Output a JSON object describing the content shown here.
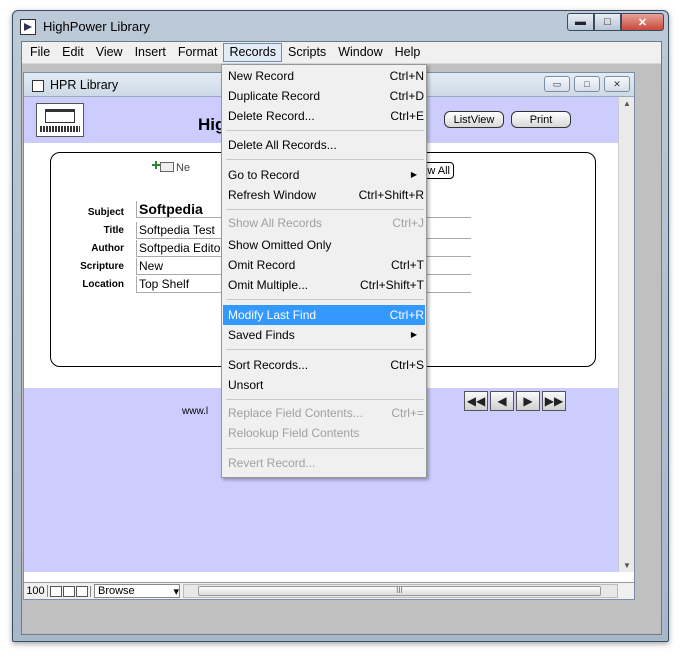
{
  "app": {
    "title": "HighPower Library"
  },
  "window_controls": {
    "minimize": "▬",
    "maximize": "□",
    "close": "✕"
  },
  "menubar": [
    {
      "label": "File"
    },
    {
      "label": "Edit"
    },
    {
      "label": "View"
    },
    {
      "label": "Insert"
    },
    {
      "label": "Format"
    },
    {
      "label": "Records"
    },
    {
      "label": "Scripts"
    },
    {
      "label": "Window"
    },
    {
      "label": "Help"
    }
  ],
  "doc_window": {
    "title": "HPR Library",
    "controls": [
      "▭",
      "□",
      "✕"
    ]
  },
  "header": {
    "heading": "Hig",
    "listview_button": "ListView",
    "print_button": "Print"
  },
  "form": {
    "new_label": "Ne",
    "show_all_button": "how All",
    "fields": [
      {
        "label": "Subject",
        "value": "Softpedia"
      },
      {
        "label": "Title",
        "value": "Softpedia Test"
      },
      {
        "label": "Author",
        "value": "Softpedia Edito"
      },
      {
        "label": "Scripture",
        "value": "New"
      },
      {
        "label": "Location",
        "value": "Top Shelf"
      }
    ]
  },
  "footer": {
    "url_text": "www.l"
  },
  "nav_buttons": [
    "◀◀",
    "◀",
    "▶",
    "▶▶"
  ],
  "statusbar": {
    "zoom": "100",
    "mode": "Browse",
    "mode_arrow": "▾",
    "thumb_grip": "III"
  },
  "records_menu": [
    {
      "label": "New Record",
      "shortcut": "Ctrl+N",
      "state": "normal"
    },
    {
      "label": "Duplicate Record",
      "shortcut": "Ctrl+D",
      "state": "normal"
    },
    {
      "label": "Delete Record...",
      "shortcut": "Ctrl+E",
      "state": "normal"
    },
    {
      "label": "Delete All Records...",
      "shortcut": "",
      "state": "normal"
    },
    {
      "label": "Go to Record",
      "shortcut": "",
      "state": "submenu"
    },
    {
      "label": "Refresh Window",
      "shortcut": "Ctrl+Shift+R",
      "state": "normal"
    },
    {
      "label": "Show All Records",
      "shortcut": "Ctrl+J",
      "state": "disabled"
    },
    {
      "label": "Show Omitted Only",
      "shortcut": "",
      "state": "normal"
    },
    {
      "label": "Omit Record",
      "shortcut": "Ctrl+T",
      "state": "normal"
    },
    {
      "label": "Omit Multiple...",
      "shortcut": "Ctrl+Shift+T",
      "state": "normal"
    },
    {
      "label": "Modify Last Find",
      "shortcut": "Ctrl+R",
      "state": "highlighted"
    },
    {
      "label": "Saved Finds",
      "shortcut": "",
      "state": "submenu"
    },
    {
      "label": "Sort Records...",
      "shortcut": "Ctrl+S",
      "state": "normal"
    },
    {
      "label": "Unsort",
      "shortcut": "",
      "state": "normal"
    },
    {
      "label": "Replace Field Contents...",
      "shortcut": "Ctrl+=",
      "state": "disabled"
    },
    {
      "label": "Relookup Field Contents",
      "shortcut": "",
      "state": "disabled"
    },
    {
      "label": "Revert Record...",
      "shortcut": "",
      "state": "disabled"
    }
  ],
  "colors": {
    "band": "#ccccff",
    "highlight": "#3399ff",
    "disabled": "#a0a0a0"
  }
}
